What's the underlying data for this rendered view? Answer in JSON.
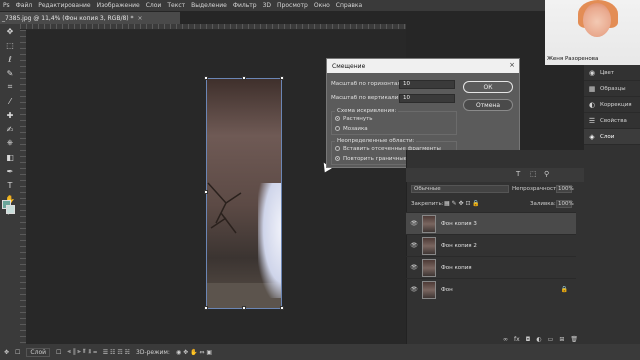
{
  "menubar": {
    "items": [
      "Файл",
      "Редактирование",
      "Изображение",
      "Слои",
      "Текст",
      "Выделение",
      "Фильтр",
      "3D",
      "Просмотр",
      "Окно",
      "Справка"
    ]
  },
  "document": {
    "tab_title": "_7385.jpg @ 11,4% (Фон копия 3, RGB/8) *"
  },
  "dialog": {
    "title": "Смещение",
    "horizontal_label": "Масштаб по горизонтали",
    "horizontal_value": "10",
    "vertical_label": "Масштаб по вертикали",
    "vertical_value": "10",
    "ok_label": "ОК",
    "cancel_label": "Отмена",
    "distortion_label": "Схема искривления:",
    "stretch_label": "Растянуть",
    "tile_label": "Мозаика",
    "undefined_label": "Неопределенные области:",
    "wrap_label": "Вставить отсеченные фрагменты",
    "repeat_label": "Повторить граничные пикселы"
  },
  "webcam": {
    "name": "Женя Разоренова"
  },
  "right_dock": {
    "items": [
      {
        "label": "Цвет",
        "icon": "color-icon"
      },
      {
        "label": "Образцы",
        "icon": "swatches-icon"
      },
      {
        "label": "Коррекция",
        "icon": "adjustments-icon"
      },
      {
        "label": "Свойства",
        "icon": "properties-icon"
      },
      {
        "label": "Слои",
        "icon": "layers-icon"
      }
    ]
  },
  "layers": {
    "blend_mode": "Обычные",
    "opacity_label": "Непрозрачность:",
    "opacity_value": "100%",
    "lock_label": "Закрепить:",
    "fill_label": "Заливка:",
    "fill_value": "100%",
    "items": [
      {
        "name": "Фон копия 3",
        "selected": true
      },
      {
        "name": "Фон копия 2",
        "selected": false
      },
      {
        "name": "Фон копия",
        "selected": false
      },
      {
        "name": "Фон",
        "selected": false
      }
    ]
  },
  "bottom_bar": {
    "layer_select": "Слой",
    "mode_3d": "3D-режим:"
  }
}
